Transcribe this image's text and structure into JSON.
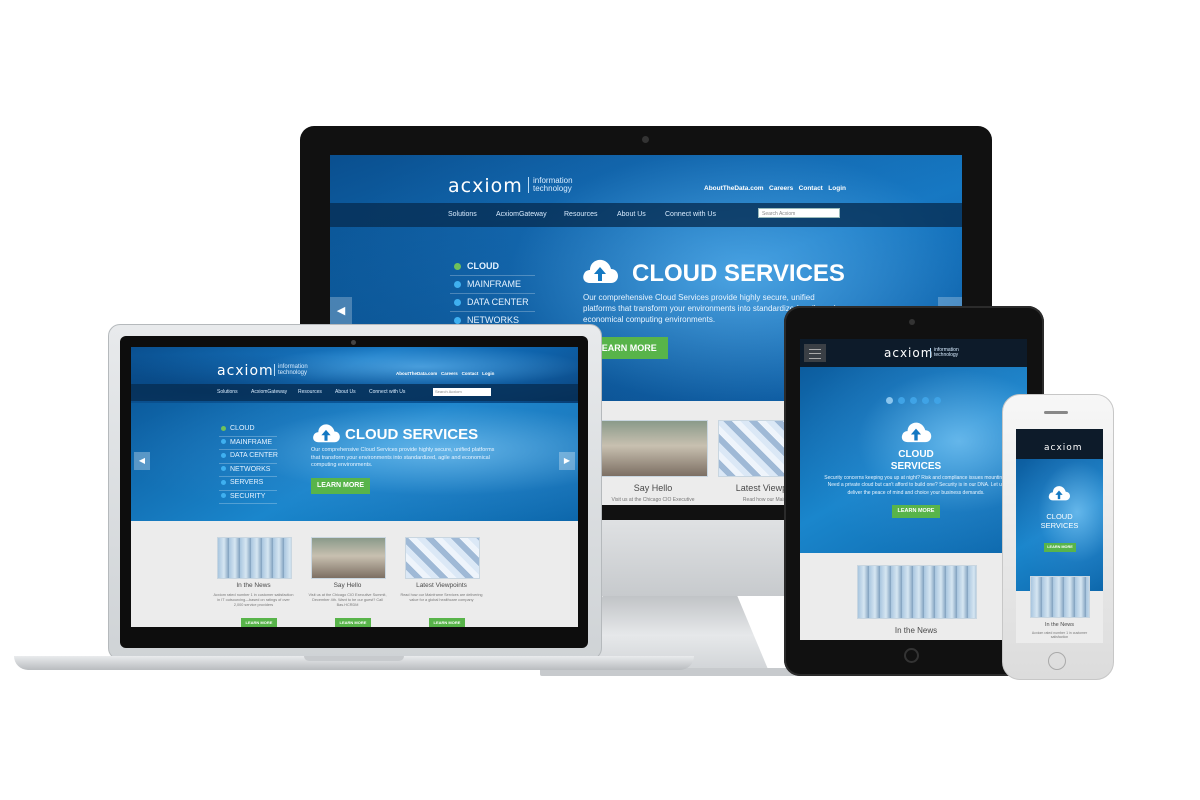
{
  "brand": {
    "logo": "acxiom",
    "tagline_line1": "information",
    "tagline_line2": "technology"
  },
  "top_links": [
    "AboutTheData.com",
    "Careers",
    "Contact",
    "Login"
  ],
  "nav": [
    "Solutions",
    "AcxiomGateway",
    "Resources",
    "About Us",
    "Connect with Us"
  ],
  "search": {
    "placeholder": "Search Acxiom"
  },
  "sidebar": [
    "CLOUD",
    "MAINFRAME",
    "DATA CENTER",
    "NETWORKS",
    "SERVERS",
    "SECURITY"
  ],
  "hero": {
    "title": "CLOUD SERVICES",
    "title_mobile_line1": "CLOUD",
    "title_mobile_line2": "SERVICES",
    "body_desktop": "Our comprehensive Cloud Services provide highly secure, unified platforms that transform your environments into standardized, agile and economical computing environments.",
    "body_tablet": "Security concerns keeping you up at night? Risk and compliance issues mounting? Need a private cloud but can't afford to build one? Security is in our DNA. Let us deliver the peace of mind and choice your business demands.",
    "cta": "LEARN MORE"
  },
  "cards": [
    {
      "title": "In the News",
      "body": "Acxiom rated number 1 in customer satisfaction in IT outsourcing—based on ratings of over 2,000 service providers",
      "cta": "LEARN MORE"
    },
    {
      "title": "Say Hello",
      "body": "Visit us at the Chicago CIO Executive Summit, December 4th. Want to be our guest? Call Bas.HCRDM",
      "cta": "LEARN MORE"
    },
    {
      "title": "Latest Viewpoints",
      "body": "Read how our Mainframe Services are delivering value for a global healthcare company",
      "cta": "LEARN MORE"
    }
  ],
  "monitor_cards": {
    "say_hello": "Say Hello",
    "latest": "Latest Viewpoints",
    "say_hello_body": "Visit us at the Chicago CIO Executive",
    "latest_body": "Read how our Mainframe"
  },
  "phone_card": {
    "title": "In the News",
    "body": "Acxiom rated number 1 in customer satisfaction"
  },
  "colors": {
    "accent_green": "#58b44a",
    "brand_blue": "#1478c2",
    "nav_dark": "#062d52"
  }
}
